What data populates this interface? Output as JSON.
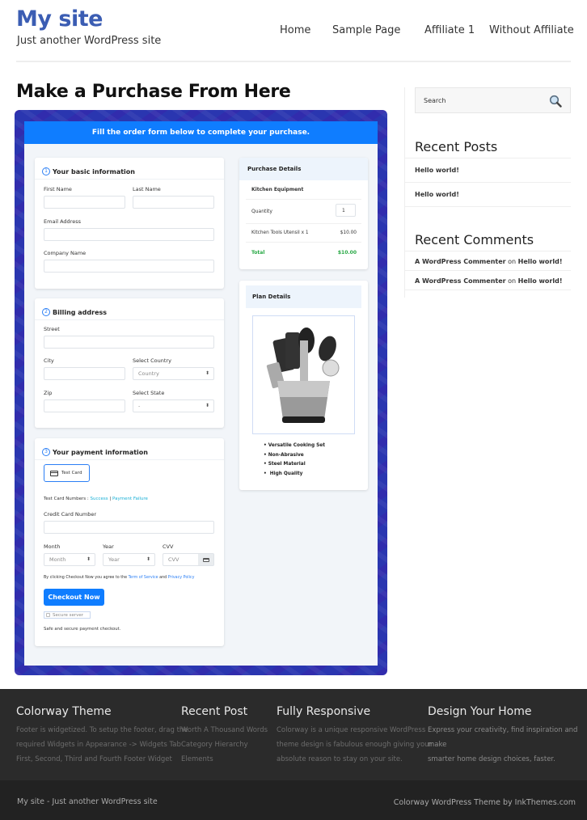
{
  "header": {
    "site_title": "My site",
    "tagline": "Just another WordPress site",
    "nav": [
      "Home",
      "Sample Page",
      "Affiliate 1",
      "Without Affiliate"
    ]
  },
  "page_title": "Make a Purchase From Here",
  "form": {
    "banner": "Fill the order form below to complete your purchase.",
    "basic": {
      "step": "1",
      "title": "Your basic information",
      "first_name_label": "First Name",
      "last_name_label": "Last Name",
      "email_label": "Email Address",
      "company_label": "Company Name"
    },
    "billing": {
      "step": "2",
      "title": "Billing address",
      "street_label": "Street",
      "city_label": "City",
      "country_label": "Select Country",
      "country_value": "Country",
      "zip_label": "Zip",
      "state_label": "Select State",
      "state_value": "-"
    },
    "payment": {
      "step": "3",
      "title": "Your payment information",
      "method_label": "Test Card",
      "test_numbers_label": "Test Card Numbers : ",
      "success_link": "Success",
      "separator": " | ",
      "failure_link": "Payment Failure",
      "card_number_label": "Credit Card Number",
      "month_label": "Month",
      "month_value": "Month",
      "year_label": "Year",
      "year_value": "Year",
      "cvv_label": "CVV",
      "cvv_placeholder": "CVV",
      "terms_prefix": "By clicking Checkout Now you agree to the ",
      "terms_link": "Term of Service",
      "terms_and": " and ",
      "privacy_link": "Privacy Policy",
      "checkout_button": "Checkout Now",
      "secure_badge": "Secure server",
      "secure_note": "Safe and secure payment checkout."
    },
    "purchase_details": {
      "title": "Purchase Details",
      "product": "Kitchen Equipment",
      "quantity_label": "Quantity",
      "quantity_value": "1",
      "line_item": "Kitchen Tools Utensil x 1",
      "line_price": "$10.00",
      "total_label": "Total",
      "total_value": "$10.00"
    },
    "plan_details": {
      "title": "Plan Details",
      "features": [
        "Versatile Cooking Set",
        "Non-Abrasive",
        "Steel Material",
        "High Quality"
      ]
    }
  },
  "sidebar": {
    "search_placeholder": "Search",
    "recent_posts_title": "Recent Posts",
    "recent_posts": [
      "Hello world!",
      "Hello world!"
    ],
    "recent_comments_title": "Recent Comments",
    "recent_comments": [
      {
        "author": "A WordPress Commenter",
        "on": " on ",
        "post": "Hello world!"
      },
      {
        "author": "A WordPress Commenter",
        "on": " on ",
        "post": "Hello world!"
      }
    ]
  },
  "footer": {
    "widgets": [
      {
        "title": "Colorway Theme",
        "lines": [
          "Footer is widgetized. To setup the footer, drag the",
          "required Widgets in Appearance -> Widgets Tab",
          "First, Second, Third and Fourth Footer Widget"
        ]
      },
      {
        "title": "Recent Post",
        "lines": [
          "Worth A Thousand Words",
          "Category Hierarchy",
          "Elements"
        ]
      },
      {
        "title": "Fully Responsive",
        "lines": [
          "Colorway is a unique responsive WordPress",
          "theme design is fabulous enough giving your",
          "absolute reason to stay on your site."
        ]
      },
      {
        "title": "Design Your Home",
        "lines": [
          "Express your creativity, find inspiration and make",
          "smarter home design choices, faster."
        ]
      }
    ],
    "copyright_left": "My site - Just another WordPress site",
    "copyright_right": "Colorway WordPress Theme by InkThemes.com"
  },
  "colors": {
    "brand": "#3b5db3",
    "banner": "#0f7dff",
    "success": "#27a844",
    "link": "#1ab0d6"
  }
}
